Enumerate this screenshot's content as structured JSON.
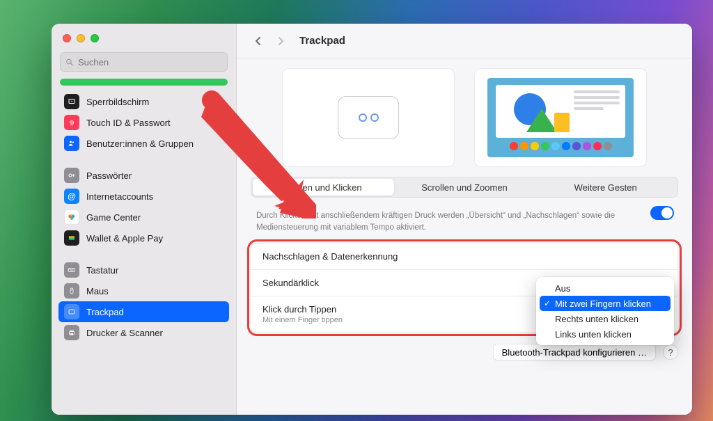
{
  "window": {
    "search_placeholder": "Suchen",
    "title": "Trackpad"
  },
  "sidebar": {
    "items": [
      {
        "label": "Sperrbildschirm",
        "icon": "lock-screen",
        "bg": "#1f1f22"
      },
      {
        "label": "Touch ID & Passwort",
        "icon": "fingerprint",
        "bg": "#ff3b5c"
      },
      {
        "label": "Benutzer:innen & Gruppen",
        "icon": "users",
        "bg": "#0a66ff"
      },
      {
        "label": "Passwörter",
        "icon": "key",
        "bg": "#8e8e93"
      },
      {
        "label": "Internetaccounts",
        "icon": "at",
        "bg": "#0a84ff"
      },
      {
        "label": "Game Center",
        "icon": "gamecenter",
        "bg": "#ffffff"
      },
      {
        "label": "Wallet & Apple Pay",
        "icon": "wallet",
        "bg": "#1f1f22"
      },
      {
        "label": "Tastatur",
        "icon": "keyboard",
        "bg": "#8e8e93"
      },
      {
        "label": "Maus",
        "icon": "mouse",
        "bg": "#8e8e93"
      },
      {
        "label": "Trackpad",
        "icon": "trackpad",
        "bg": "#8e8e93",
        "selected": true
      },
      {
        "label": "Drucker & Scanner",
        "icon": "printer",
        "bg": "#8e8e93"
      }
    ]
  },
  "tabs": {
    "items": [
      {
        "label": "Zeigen und Klicken",
        "active": true
      },
      {
        "label": "Scrollen und Zoomen"
      },
      {
        "label": "Weitere Gesten"
      }
    ]
  },
  "hint": "Durch Klicken mit anschließendem kräftigen Druck werden „Übersicht“ und „Nachschlagen“ sowie die Mediensteuerung mit variablem Tempo aktiviert.",
  "rows": {
    "lookup": {
      "title": "Nachschlagen & Datenerkennung",
      "value": ""
    },
    "secondary": {
      "title": "Sekundärklick"
    },
    "tap": {
      "title": "Klick durch Tippen",
      "subtitle": "Mit einem Finger tippen"
    }
  },
  "dropdown": {
    "items": [
      {
        "label": "Aus"
      },
      {
        "label": "Mit zwei Fingern klicken",
        "selected": true
      },
      {
        "label": "Rechts unten klicken"
      },
      {
        "label": "Links unten klicken"
      }
    ]
  },
  "footer": {
    "configure": "Bluetooth-Trackpad konfigurieren …",
    "help": "?"
  },
  "swatch_colors": [
    "#ff3b30",
    "#ff9500",
    "#ffcc00",
    "#34c759",
    "#5ac8fa",
    "#007aff",
    "#5856d6",
    "#af52de",
    "#ff2d55",
    "#8e8e93"
  ]
}
